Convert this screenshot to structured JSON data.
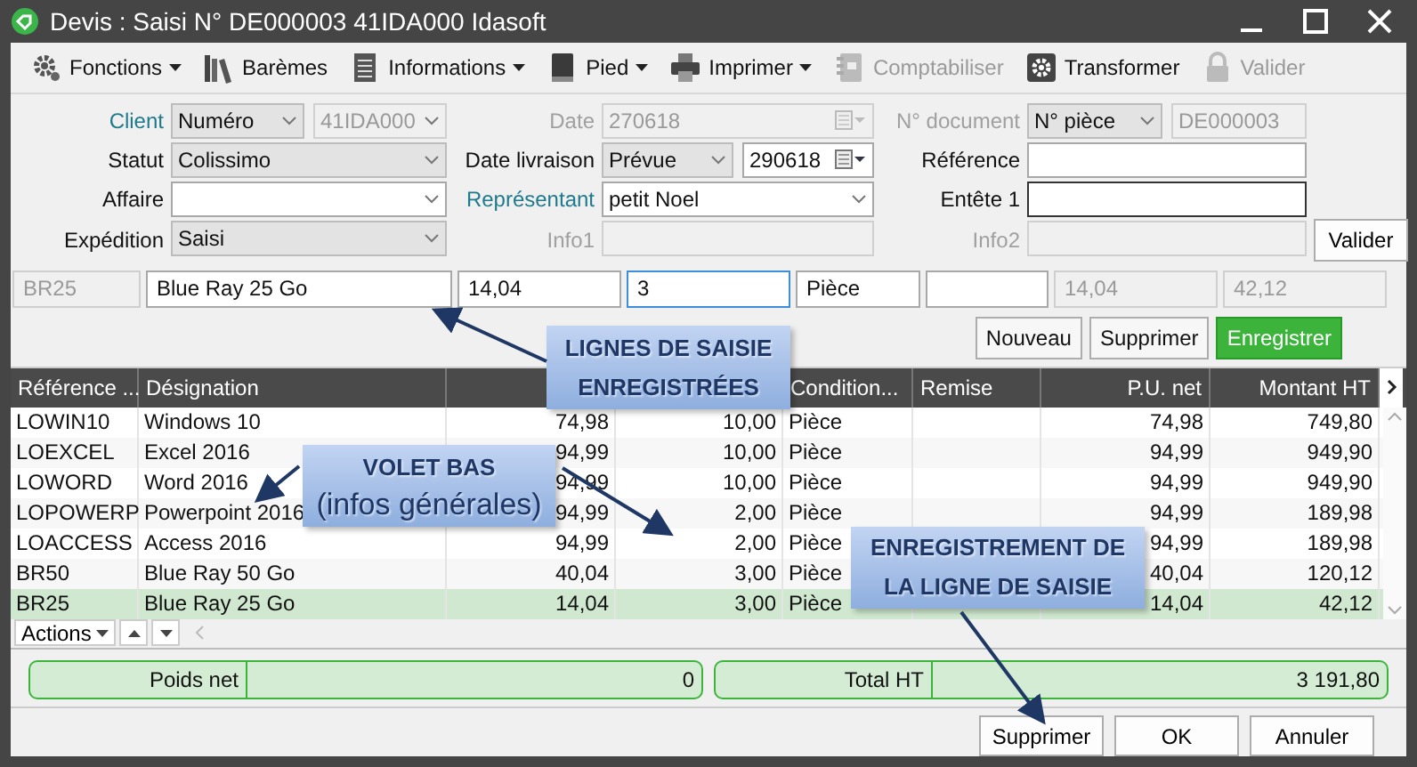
{
  "window": {
    "title": "Devis : Saisi N° DE000003 41IDA000 Idasoft"
  },
  "toolbar": [
    {
      "label": "Fonctions",
      "dropdown": true,
      "disabled": false
    },
    {
      "label": "Barèmes",
      "dropdown": false,
      "disabled": false
    },
    {
      "label": "Informations",
      "dropdown": true,
      "disabled": false
    },
    {
      "label": "Pied",
      "dropdown": true,
      "disabled": false
    },
    {
      "label": "Imprimer",
      "dropdown": true,
      "disabled": false
    },
    {
      "label": "Comptabiliser",
      "dropdown": false,
      "disabled": true
    },
    {
      "label": "Transformer",
      "dropdown": false,
      "disabled": false
    },
    {
      "label": "Valider",
      "dropdown": false,
      "disabled": true
    }
  ],
  "form": {
    "rows": [
      [
        {
          "label": "Client",
          "link": true,
          "disabled": false,
          "fields": [
            {
              "kind": "dropdown",
              "value": "Numéro",
              "disabled": false
            },
            {
              "kind": "combo",
              "value": "41IDA000",
              "disabled": true
            }
          ]
        },
        {
          "label": "Date",
          "link": false,
          "disabled": true,
          "fields": [
            {
              "kind": "date",
              "value": "270618",
              "disabled": true
            }
          ]
        },
        {
          "label": "N° document",
          "link": false,
          "disabled": true,
          "fields": [
            {
              "kind": "dropdown",
              "value": "N° pièce",
              "disabled": false
            },
            {
              "kind": "text",
              "value": "DE000003",
              "disabled": true
            }
          ]
        }
      ],
      [
        {
          "label": "Statut",
          "link": false,
          "disabled": false,
          "fields": [
            {
              "kind": "dropdown",
              "value": "Colissimo",
              "disabled": false
            }
          ]
        },
        {
          "label": "Date livraison",
          "link": false,
          "disabled": false,
          "fields": [
            {
              "kind": "dropdown",
              "value": "Prévue",
              "disabled": false
            },
            {
              "kind": "date",
              "value": "290618",
              "disabled": false
            }
          ]
        },
        {
          "label": "Référence",
          "link": false,
          "disabled": false,
          "fields": [
            {
              "kind": "text",
              "disabled": false,
              "focused": false
            }
          ]
        }
      ],
      [
        {
          "label": "Affaire",
          "link": false,
          "disabled": false,
          "fields": [
            {
              "kind": "combo",
              "disabled": false
            }
          ]
        },
        {
          "label": "Représentant",
          "link": true,
          "disabled": false,
          "fields": [
            {
              "kind": "combo",
              "value": "petit Noel",
              "disabled": false
            }
          ]
        },
        {
          "label": "Entête 1",
          "link": false,
          "disabled": false,
          "fields": [
            {
              "kind": "text",
              "disabled": false,
              "focused": true
            }
          ]
        }
      ],
      [
        {
          "label": "Expédition",
          "link": false,
          "disabled": false,
          "fields": [
            {
              "kind": "dropdown",
              "value": "Saisi",
              "disabled": false
            }
          ]
        },
        {
          "label": "Info1",
          "link": false,
          "disabled": true,
          "fields": [
            {
              "kind": "text",
              "disabled": true
            }
          ]
        },
        {
          "label": "Info2",
          "link": false,
          "disabled": true,
          "fields": [
            {
              "kind": "text",
              "disabled": true
            }
          ]
        }
      ]
    ],
    "button": "Valider"
  },
  "entry": [
    {
      "value": "BR25",
      "disabled": true,
      "focused": false
    },
    {
      "value": "Blue Ray 25 Go",
      "disabled": false,
      "focused": false
    },
    {
      "value": "14,04",
      "disabled": false,
      "focused": false
    },
    {
      "value": "3",
      "disabled": false,
      "focused": true
    },
    {
      "value": "Pièce",
      "disabled": false,
      "focused": false
    },
    {
      "disabled": false,
      "focused": false
    },
    {
      "value": "14,04",
      "disabled": true,
      "focused": false
    },
    {
      "value": "42,12",
      "disabled": true,
      "focused": false
    }
  ],
  "line_buttons": [
    {
      "label": "Nouveau",
      "kind": "normal"
    },
    {
      "label": "Supprimer",
      "kind": "normal"
    },
    {
      "label": "Enregistrer",
      "kind": "primary"
    }
  ],
  "table": {
    "columns": [
      {
        "label": "Référence ..."
      },
      {
        "label": "Désignation"
      },
      {},
      {},
      {
        "label": "Condition..."
      },
      {
        "label": "Remise"
      },
      {
        "label": "P.U. net"
      },
      {
        "label": "Montant HT"
      }
    ],
    "rows": [
      {
        "reference": "LOWIN10",
        "designation": "Windows 10",
        "column_3": "74,98",
        "column_4": "10,00",
        "condition": "Pièce",
        "pu_net": "74,98",
        "montant_ht": "749,80",
        "selected": false
      },
      {
        "reference": "LOEXCEL",
        "designation": "Excel 2016",
        "column_3": "94,99",
        "column_4": "10,00",
        "condition": "Pièce",
        "pu_net": "94,99",
        "montant_ht": "949,90",
        "selected": false
      },
      {
        "reference": "LOWORD",
        "designation": "Word 2016",
        "column_3": "94,99",
        "column_4": "10,00",
        "condition": "Pièce",
        "pu_net": "94,99",
        "montant_ht": "949,90",
        "selected": false
      },
      {
        "reference": "LOPOWERP",
        "designation": "Powerpoint 2016",
        "column_3": "94,99",
        "column_4": "2,00",
        "condition": "Pièce",
        "pu_net": "94,99",
        "montant_ht": "189,98",
        "selected": false
      },
      {
        "reference": "LOACCESS",
        "designation": "Access 2016",
        "column_3": "94,99",
        "column_4": "2,00",
        "condition": "Pièce",
        "pu_net": "94,99",
        "montant_ht": "189,98",
        "selected": false
      },
      {
        "reference": "BR50",
        "designation": "Blue Ray 50 Go",
        "column_3": "40,04",
        "column_4": "3,00",
        "condition": "Pièce",
        "pu_net": "40,04",
        "montant_ht": "120,12",
        "selected": false
      },
      {
        "reference": "BR25",
        "designation": "Blue Ray 25 Go",
        "column_3": "14,04",
        "column_4": "3,00",
        "condition": "Pièce",
        "pu_net": "14,04",
        "montant_ht": "42,12",
        "selected": true
      }
    ]
  },
  "actions": {
    "label": "Actions"
  },
  "totals": [
    {
      "label": "Poids net",
      "value": "0"
    },
    {
      "label": "Total HT",
      "value": "3 191,80"
    }
  ],
  "footer_buttons": [
    "Supprimer",
    "OK",
    "Annuler"
  ],
  "callouts": [
    {
      "lines": [
        {
          "text": "LIGNES DE SAISIE",
          "bold": true
        },
        {
          "text": "ENREGISTRÉES",
          "bold": true
        }
      ]
    },
    {
      "lines": [
        {
          "text": "VOLET BAS",
          "bold": true
        },
        {
          "text": "(infos générales)",
          "bold": false
        }
      ]
    },
    {
      "lines": [
        {
          "text": "ENREGISTREMENT DE",
          "bold": true
        },
        {
          "text": "LA LIGNE DE SAISIE",
          "bold": true
        }
      ]
    }
  ]
}
